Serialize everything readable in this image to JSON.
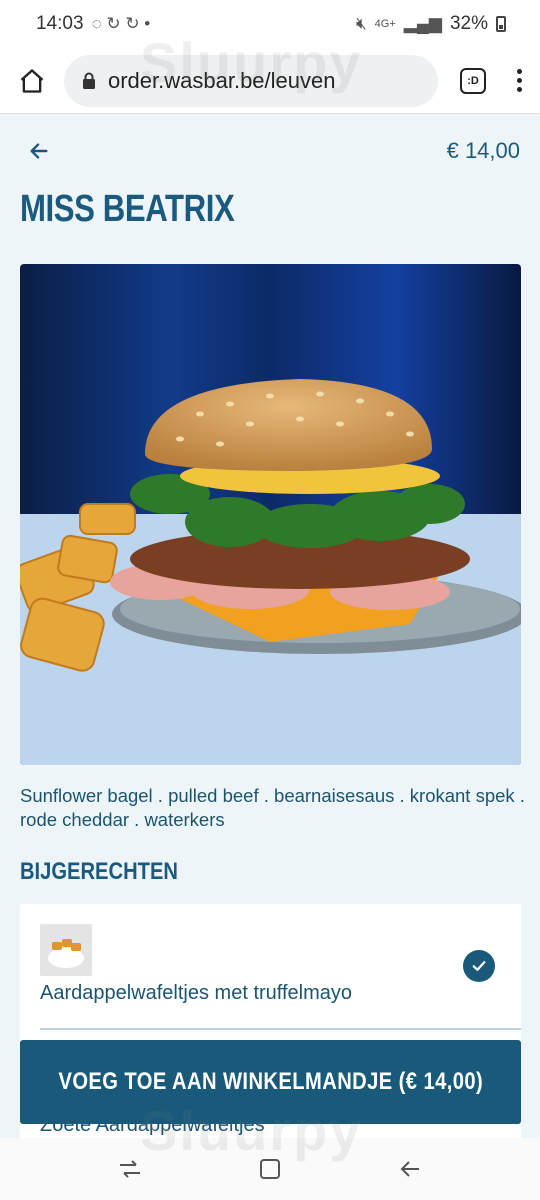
{
  "status_bar": {
    "time": "14:03",
    "battery": "32%",
    "network": "4G+"
  },
  "browser": {
    "url": "order.wasbar.be/leuven",
    "tab_label": ":D"
  },
  "product": {
    "price": "€ 14,00",
    "title": "MISS BEATRIX",
    "description": "Sunflower bagel . pulled beef . bearnaisesaus . krokant spek . rode cheddar . waterkers"
  },
  "sides": {
    "title": "BIJGERECHTEN",
    "items": [
      {
        "name": "Aardappelwafeltjes met truffelmayo",
        "selected": true
      },
      {
        "name": "Zoete Aardappelwafeltjes",
        "selected": false
      }
    ]
  },
  "cart_button": {
    "label": "VOEG TOE AAN WINKELMANDJE (€ 14,00)"
  },
  "watermark": "Sluurpy",
  "colors": {
    "brand": "#195a7a",
    "background": "#eef5f9",
    "title": "#1b5a7e"
  },
  "icons": {
    "home": "home-icon",
    "lock": "lock-icon",
    "menu": "more-vert-icon",
    "back": "arrow-left-icon",
    "check": "check-icon"
  }
}
